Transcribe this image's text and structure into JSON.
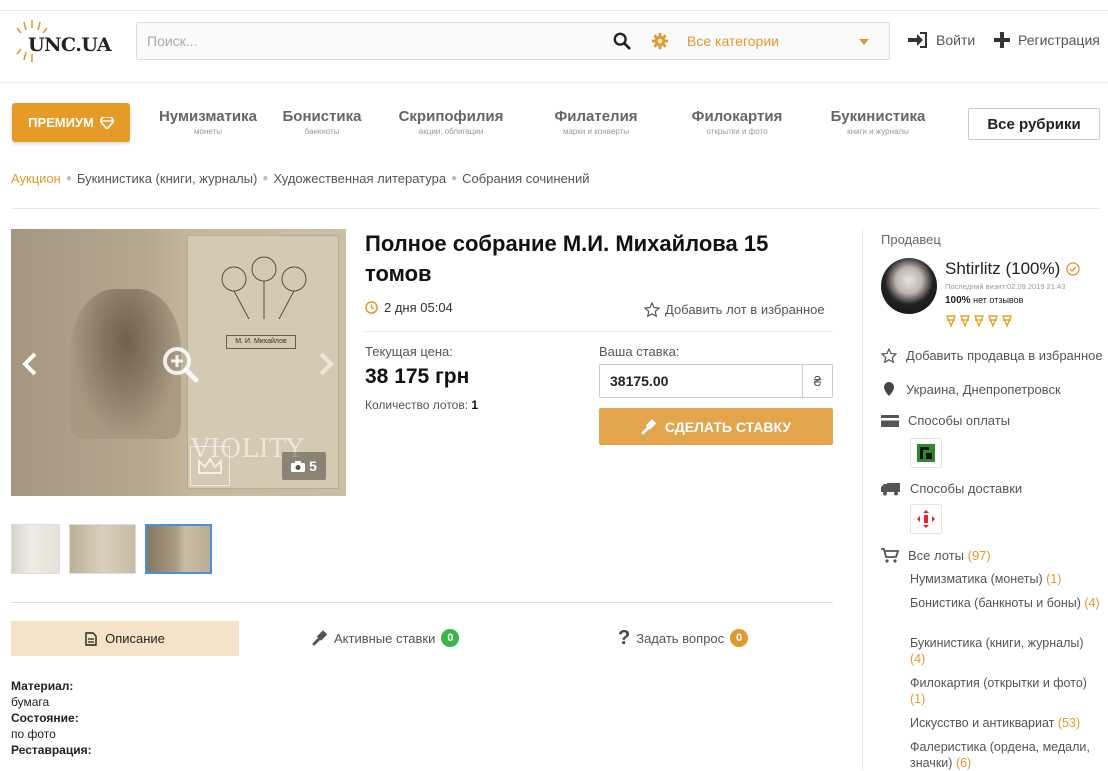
{
  "header": {
    "logo_text": "UNC.UA",
    "search_placeholder": "Поиск...",
    "category_select": "Все категории",
    "login": "Войти",
    "register": "Регистрация"
  },
  "nav": {
    "premium": "ПРЕМИУМ",
    "items": [
      {
        "title": "Нумизматика",
        "sub": "монеты"
      },
      {
        "title": "Бонистика",
        "sub": "банкноты"
      },
      {
        "title": "Скрипофилия",
        "sub": "акции, облигации"
      },
      {
        "title": "Филателия",
        "sub": "марки и конверты"
      },
      {
        "title": "Филокартия",
        "sub": "открытки и фото"
      },
      {
        "title": "Букинистика",
        "sub": "книги и журналы"
      }
    ],
    "all_rubrics": "Все рубрики"
  },
  "breadcrumb": [
    "Аукцион",
    "Букинистика (книги, журналы)",
    "Художественная литература",
    "Собрания сочинений"
  ],
  "gallery": {
    "photo_count": "5",
    "watermark_text": "VIOLITY",
    "page_title": "М. И. Михайлов"
  },
  "lot": {
    "title": "Полное собрание М.И. Михайлова 15 томов",
    "timer": "2 дня 05:04",
    "add_favorite": "Добавить лот в избранное",
    "current_price_label": "Текущая цена:",
    "current_price": "38 175 грн",
    "quantity_label": "Количество лотов:",
    "quantity": "1",
    "bid_label": "Ваша ставка:",
    "bid_value": "38175.00",
    "currency_symbol": "₴",
    "bid_button": "СДЕЛАТЬ СТАВКУ"
  },
  "tabs": {
    "description": "Описание",
    "active_bids": "Активные ставки",
    "active_bids_count": "0",
    "ask_question": "Задать вопрос",
    "ask_question_count": "0"
  },
  "description": {
    "material_label": "Материал:",
    "material": "бумага",
    "condition_label": "Состояние:",
    "condition": "по фото",
    "restoration_label": "Реставрация:"
  },
  "seller": {
    "label": "Продавец",
    "name": "Shtirlitz (100%)",
    "last_visit": "Последний визит:02.09.2019 21:43",
    "rating_pct": "100%",
    "rating_text": "нет отзывов",
    "add_seller_favorite": "Добавить продавца в избранное",
    "location": "Украина, Днепропетровск",
    "payment_label": "Способы оплаты",
    "delivery_label": "Способы доставки",
    "all_lots_label": "Все лоты",
    "all_lots_count": "(97)",
    "categories": [
      {
        "name": "Нумизматика (монеты)",
        "count": "(1)"
      },
      {
        "name": "Бонистика (банкноты и боны)",
        "count": "(4)"
      },
      {
        "name": "Букинистика (книги, журналы)",
        "count": "(4)"
      },
      {
        "name": "Филокартия (открытки и фото)",
        "count": "(1)"
      },
      {
        "name": "Искусство и антиквариат",
        "count": "(53)"
      },
      {
        "name": "Фалеристика (ордена, медали, значки)",
        "count": "(6)"
      }
    ]
  },
  "colors": {
    "accent": "#e19a2e",
    "premium": "#e69a27",
    "bid_button": "#e2a54d",
    "tab_active": "#f5e3c7",
    "badge_green": "#39b54a",
    "badge_orange": "#e19a2e"
  }
}
